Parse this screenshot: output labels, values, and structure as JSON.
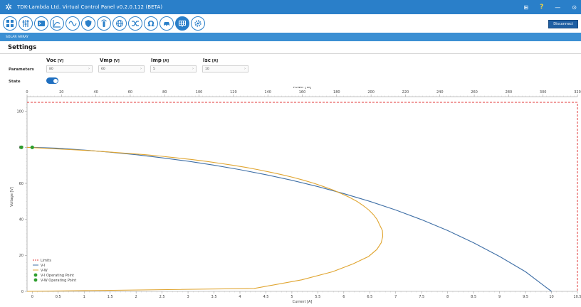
{
  "window": {
    "title": "TDK-Lambda Ltd. Virtual Control Panel v0.2.0.112 (BETA)",
    "controls": [
      "⊞",
      "?",
      "—",
      "⊙"
    ]
  },
  "toolbar": {
    "buttons": [
      "grid-icon",
      "sliders-icon",
      "terminal-icon",
      "graph-icon",
      "sine-wave-icon",
      "shield-icon",
      "sensor-icon",
      "globe-icon",
      "shuffle-icon",
      "omega-icon",
      "car-icon",
      "solar-panel-icon",
      "settings-icon"
    ],
    "active_index": 11,
    "disconnect_label": "Disconnect"
  },
  "subbar": {
    "label": "SOLAR ARRAY"
  },
  "settings": {
    "title": "Settings",
    "parameters_label": "Parameters",
    "state_label": "State",
    "state_on": true,
    "params": [
      {
        "name": "Voc",
        "unit": "[V]",
        "value": "80"
      },
      {
        "name": "Vmp",
        "unit": "[V]",
        "value": "60"
      },
      {
        "name": "Imp",
        "unit": "[A]",
        "value": "5"
      },
      {
        "name": "Isc",
        "unit": "[A]",
        "value": "10"
      }
    ]
  },
  "chart_data": {
    "type": "line",
    "xlabel": "Current [A]",
    "x2label": "Power [W]",
    "ylabel": "Voltage [V]",
    "xlim": [
      -0.1,
      10.5
    ],
    "x2lim": [
      0,
      320
    ],
    "ylim": [
      0,
      105
    ],
    "x_ticks": [
      0,
      0.5,
      1,
      1.5,
      2,
      2.5,
      3,
      3.5,
      4,
      4.5,
      5,
      5.5,
      6,
      6.5,
      7,
      7.5,
      8,
      8.5,
      9,
      9.5,
      10,
      10.5
    ],
    "x2_ticks": [
      0,
      20,
      40,
      60,
      80,
      100,
      120,
      140,
      160,
      180,
      200,
      220,
      240,
      260,
      280,
      300,
      320
    ],
    "y_ticks": [
      0,
      20,
      40,
      60,
      80,
      100
    ],
    "grid": false,
    "legend_position": "bottom-left",
    "limits": {
      "current_max": 10.5,
      "voltage_max": 105,
      "power_max": 320
    },
    "series": [
      {
        "name": "Limits",
        "color": "#e03a3a",
        "style": "dashed"
      },
      {
        "name": "V-I",
        "color": "#3f6fa6",
        "x": [
          0,
          0.5,
          1,
          1.5,
          2,
          2.5,
          3,
          3.5,
          4,
          4.5,
          5,
          5.5,
          6,
          6.5,
          7,
          7.5,
          8,
          8.5,
          9,
          9.5,
          10
        ],
        "y": [
          80,
          79.5,
          78.5,
          77.3,
          75.9,
          74.2,
          72.3,
          70.1,
          67.6,
          64.8,
          61.7,
          58.2,
          54.3,
          50.0,
          45.2,
          39.8,
          33.8,
          27.0,
          19.4,
          10.9,
          0
        ]
      },
      {
        "name": "V-W",
        "color": "#e0a530",
        "x": [
          0,
          9.9,
          19.7,
          29.7,
          39.6,
          49.4,
          59.1,
          68.8,
          77.8,
          86.6,
          95.2,
          103.5,
          111.6,
          119.4,
          127.0,
          134.3,
          141.4,
          148.1,
          154.7,
          160.9,
          166.9,
          172.4,
          177.9,
          182.8,
          187.5,
          191.8,
          195.5,
          198.7,
          201.4,
          203.6,
          205.0,
          206.6,
          206.8,
          205.9,
          203.4,
          198.6,
          189.6,
          177.6,
          159.6,
          132.0,
          0
        ],
        "y": [
          80,
          79.5,
          79,
          78.5,
          78,
          77.3,
          76.6,
          75.9,
          75.1,
          74.2,
          73.3,
          72.3,
          71.2,
          70.1,
          68.9,
          67.6,
          66.2,
          64.8,
          63.3,
          61.7,
          60.0,
          58.2,
          56.3,
          54.3,
          52.2,
          50.0,
          47.6,
          45.2,
          42.6,
          39.8,
          36.9,
          33.8,
          30.5,
          27.0,
          23.3,
          19.4,
          15.3,
          10.9,
          6.4,
          1.6,
          0
        ]
      },
      {
        "name": "V-I Operating Point",
        "color": "#2e9e2e",
        "x": [
          0
        ],
        "y": [
          80
        ]
      },
      {
        "name": "V-W Operating Point",
        "color": "#2e9e2e",
        "x": [
          0
        ],
        "y": [
          80
        ]
      }
    ]
  }
}
